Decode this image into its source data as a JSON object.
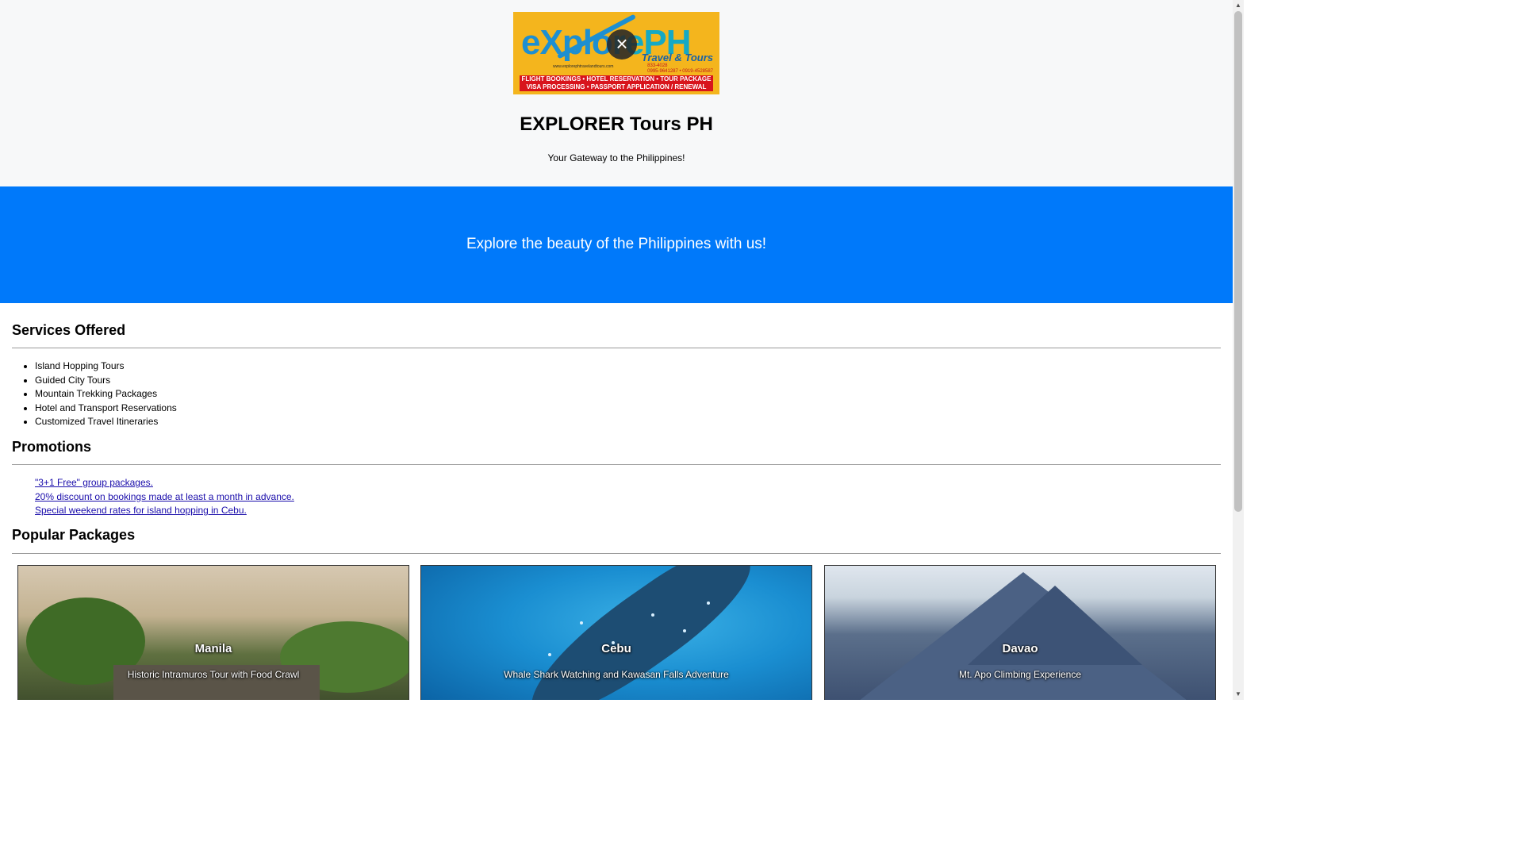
{
  "header": {
    "logo": {
      "brand_left": "eXplo",
      "brand_right": "rePH",
      "tagline": "Travel & Tours",
      "website": "www.explorephtravelandtours.com",
      "phone_1": "833-4028",
      "phone_2": "0995-9641287 • 0919-4528587",
      "services_line_1": "FLIGHT BOOKINGS • HOTEL RESERVATION • TOUR PACKAGE",
      "services_line_2": "VISA PROCESSING • PASSPORT APPLICATION / RENEWAL"
    },
    "close_icon_glyph": "×",
    "title": "EXPLORER Tours PH",
    "subtitle": "Your Gateway to the Philippines!"
  },
  "hero": {
    "text": "Explore the beauty of the Philippines with us!",
    "background_color": "#0079fa"
  },
  "services": {
    "heading": "Services Offered",
    "items": [
      "Island Hopping Tours",
      "Guided City Tours",
      "Mountain Trekking Packages",
      "Hotel and Transport Reservations",
      "Customized Travel Itineraries"
    ]
  },
  "promotions": {
    "heading": "Promotions",
    "links": [
      "\"3+1 Free\" group packages.",
      "20% discount on bookings made at least a month in advance.",
      "Special weekend rates for island hopping in Cebu."
    ],
    "link_color": "#1a0dab"
  },
  "packages": {
    "heading": "Popular Packages",
    "cards": [
      {
        "title": "Manila",
        "description": "Historic Intramuros Tour with Food Crawl"
      },
      {
        "title": "Cebu",
        "description": "Whale Shark Watching and Kawasan Falls Adventure"
      },
      {
        "title": "Davao",
        "description": "Mt. Apo Climbing Experience"
      }
    ]
  },
  "scrollbar": {
    "up_glyph": "▲",
    "down_glyph": "▼"
  }
}
